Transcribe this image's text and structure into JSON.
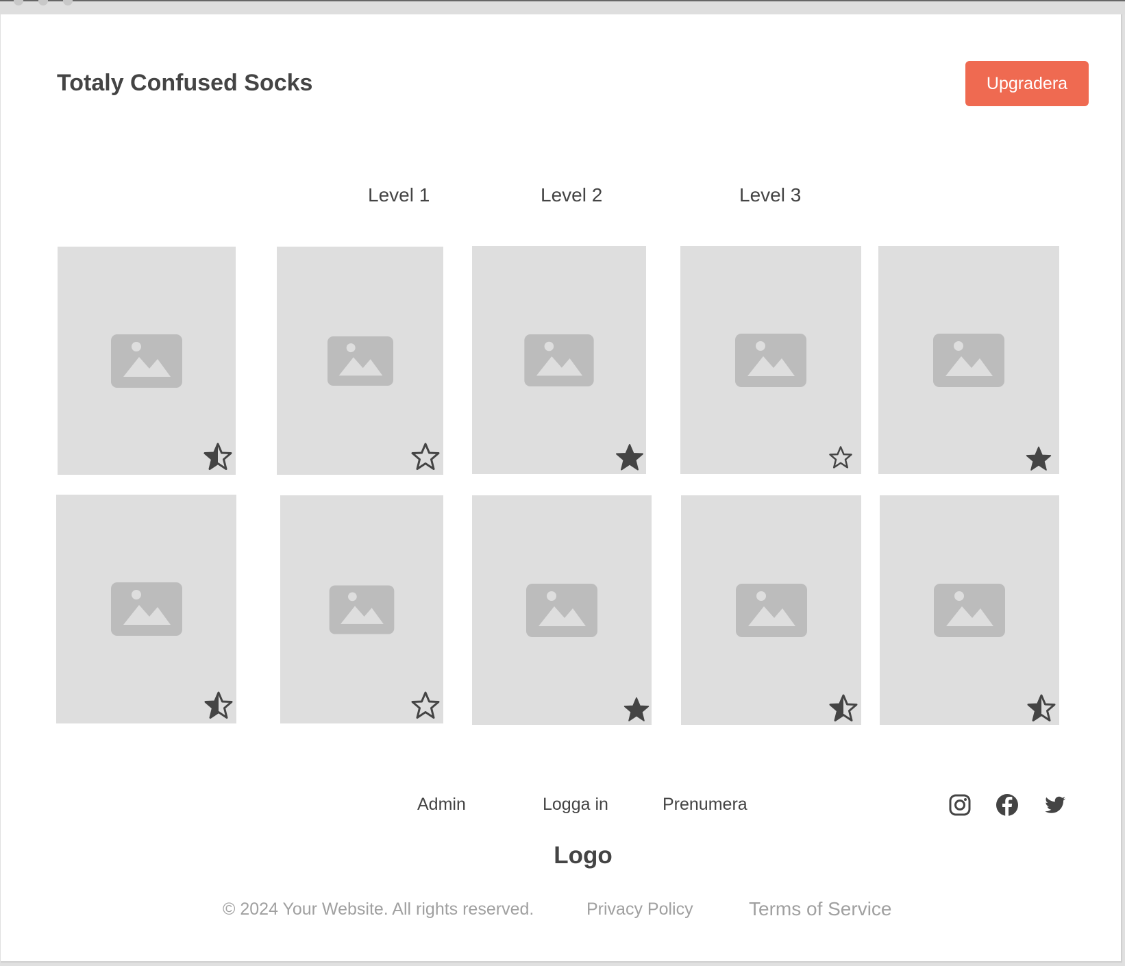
{
  "header": {
    "title": "Totaly Confused Socks",
    "upgrade_label": "Upgradera"
  },
  "levels": [
    "Level 1",
    "Level 2",
    "Level 3"
  ],
  "gallery": {
    "row1": [
      {
        "image": "image-placeholder-icon",
        "rating": "half-star-icon"
      },
      {
        "image": "image-placeholder-icon",
        "rating": "outline-star-icon"
      },
      {
        "image": "image-placeholder-icon",
        "rating": "filled-star-icon"
      },
      {
        "image": "image-placeholder-icon",
        "rating": "outline-star-icon"
      },
      {
        "image": "image-placeholder-icon",
        "rating": "filled-star-icon"
      }
    ],
    "row2": [
      {
        "image": "image-placeholder-icon",
        "rating": "half-star-icon"
      },
      {
        "image": "image-placeholder-icon",
        "rating": "outline-star-icon"
      },
      {
        "image": "image-placeholder-icon",
        "rating": "filled-star-icon"
      },
      {
        "image": "image-placeholder-icon",
        "rating": "half-star-icon"
      },
      {
        "image": "image-placeholder-icon",
        "rating": "half-star-icon"
      }
    ]
  },
  "footer": {
    "links": [
      "Admin",
      "Logga in",
      "Prenumera"
    ],
    "social": [
      "instagram-icon",
      "facebook-icon",
      "twitter-icon"
    ],
    "logo": "Logo",
    "copyright": "© 2024 Your Website. All rights reserved.",
    "privacy": "Privacy Policy",
    "terms": "Terms of Service"
  },
  "colors": {
    "accent": "#ef6a51",
    "card_bg": "#dedede",
    "icon_gray": "#bcbcbc",
    "text": "#444444",
    "muted_text": "#a0a0a0"
  }
}
